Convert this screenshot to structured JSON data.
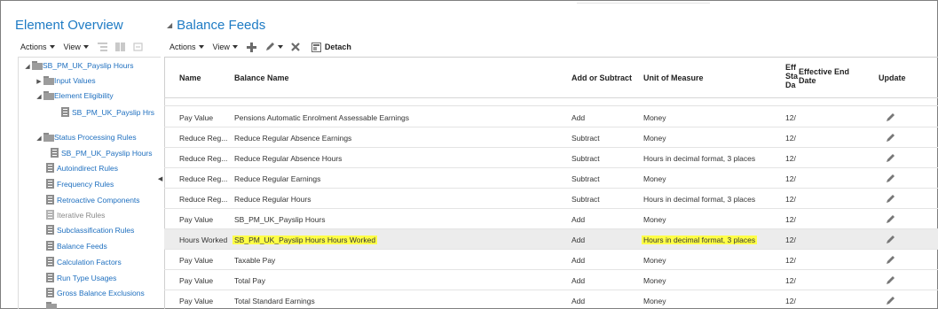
{
  "left_panel": {
    "title": "Element Overview",
    "toolbar": {
      "actions_label": "Actions",
      "view_label": "View"
    },
    "tree": {
      "root": "SB_PM_UK_Payslip Hours",
      "input_values": "Input Values",
      "element_eligibility": "Element Eligibility",
      "eligibility_child": "SB_PM_UK_Payslip Hrs",
      "status_processing_rules": "Status Processing Rules",
      "status_child": "SB_PM_UK_Payslip Hours",
      "autoindirect_rules": "Autoindirect Rules",
      "frequency_rules": "Frequency Rules",
      "retroactive_components": "Retroactive Components",
      "iterative_rules": "Iterative Rules",
      "subclassification_rules": "Subclassification Rules",
      "balance_feeds": "Balance Feeds",
      "calculation_factors": "Calculation Factors",
      "run_type_usages": "Run Type Usages",
      "gross_balance_exclusions": "Gross Balance Exclusions"
    }
  },
  "right_panel": {
    "title": "Balance Feeds",
    "toolbar": {
      "actions_label": "Actions",
      "view_label": "View",
      "detach_label": "Detach"
    },
    "columns": {
      "name": "Name",
      "balance_name": "Balance Name",
      "add_or_subtract": "Add or Subtract",
      "unit_of_measure": "Unit of Measure",
      "effective_start_1": "Eff",
      "effective_start_2": "Sta",
      "effective_start_3": "Da",
      "effective_end_1": "Effective End",
      "effective_end_2": "Date",
      "update": "Update"
    },
    "rows": [
      {
        "name": "Pay Value",
        "balance": "Pensions Automatic Enrolment Assessable Earnings",
        "op": "Add",
        "uom": "Money",
        "start": "12/"
      },
      {
        "name": "Reduce Reg...",
        "balance": "Reduce Regular Absence Earnings",
        "op": "Subtract",
        "uom": "Money",
        "start": "12/"
      },
      {
        "name": "Reduce Reg...",
        "balance": "Reduce Regular Absence Hours",
        "op": "Subtract",
        "uom": "Hours in decimal format, 3 places",
        "start": "12/"
      },
      {
        "name": "Reduce Reg...",
        "balance": "Reduce Regular Earnings",
        "op": "Subtract",
        "uom": "Money",
        "start": "12/"
      },
      {
        "name": "Reduce Reg...",
        "balance": "Reduce Regular Hours",
        "op": "Subtract",
        "uom": "Hours in decimal format, 3 places",
        "start": "12/"
      },
      {
        "name": "Pay Value",
        "balance": "SB_PM_UK_Payslip Hours",
        "op": "Add",
        "uom": "Money",
        "start": "12/"
      },
      {
        "name": "Hours Worked",
        "balance": "SB_PM_UK_Payslip Hours Hours Worked",
        "op": "Add",
        "uom": "Hours in decimal format, 3 places",
        "start": "12/"
      },
      {
        "name": "Pay Value",
        "balance": "Taxable Pay",
        "op": "Add",
        "uom": "Money",
        "start": "12/"
      },
      {
        "name": "Pay Value",
        "balance": "Total Pay",
        "op": "Add",
        "uom": "Money",
        "start": "12/"
      },
      {
        "name": "Pay Value",
        "balance": "Total Standard Earnings",
        "op": "Add",
        "uom": "Money",
        "start": "12/"
      }
    ],
    "selected_row": 6,
    "highlight_color": "#ffff47"
  },
  "icons": {
    "add": "plus-icon",
    "edit": "pencil-icon",
    "delete": "x-icon",
    "detach": "detach-icon"
  },
  "colors": {
    "title": "#1e7bc4",
    "link": "#1e6fbf"
  }
}
